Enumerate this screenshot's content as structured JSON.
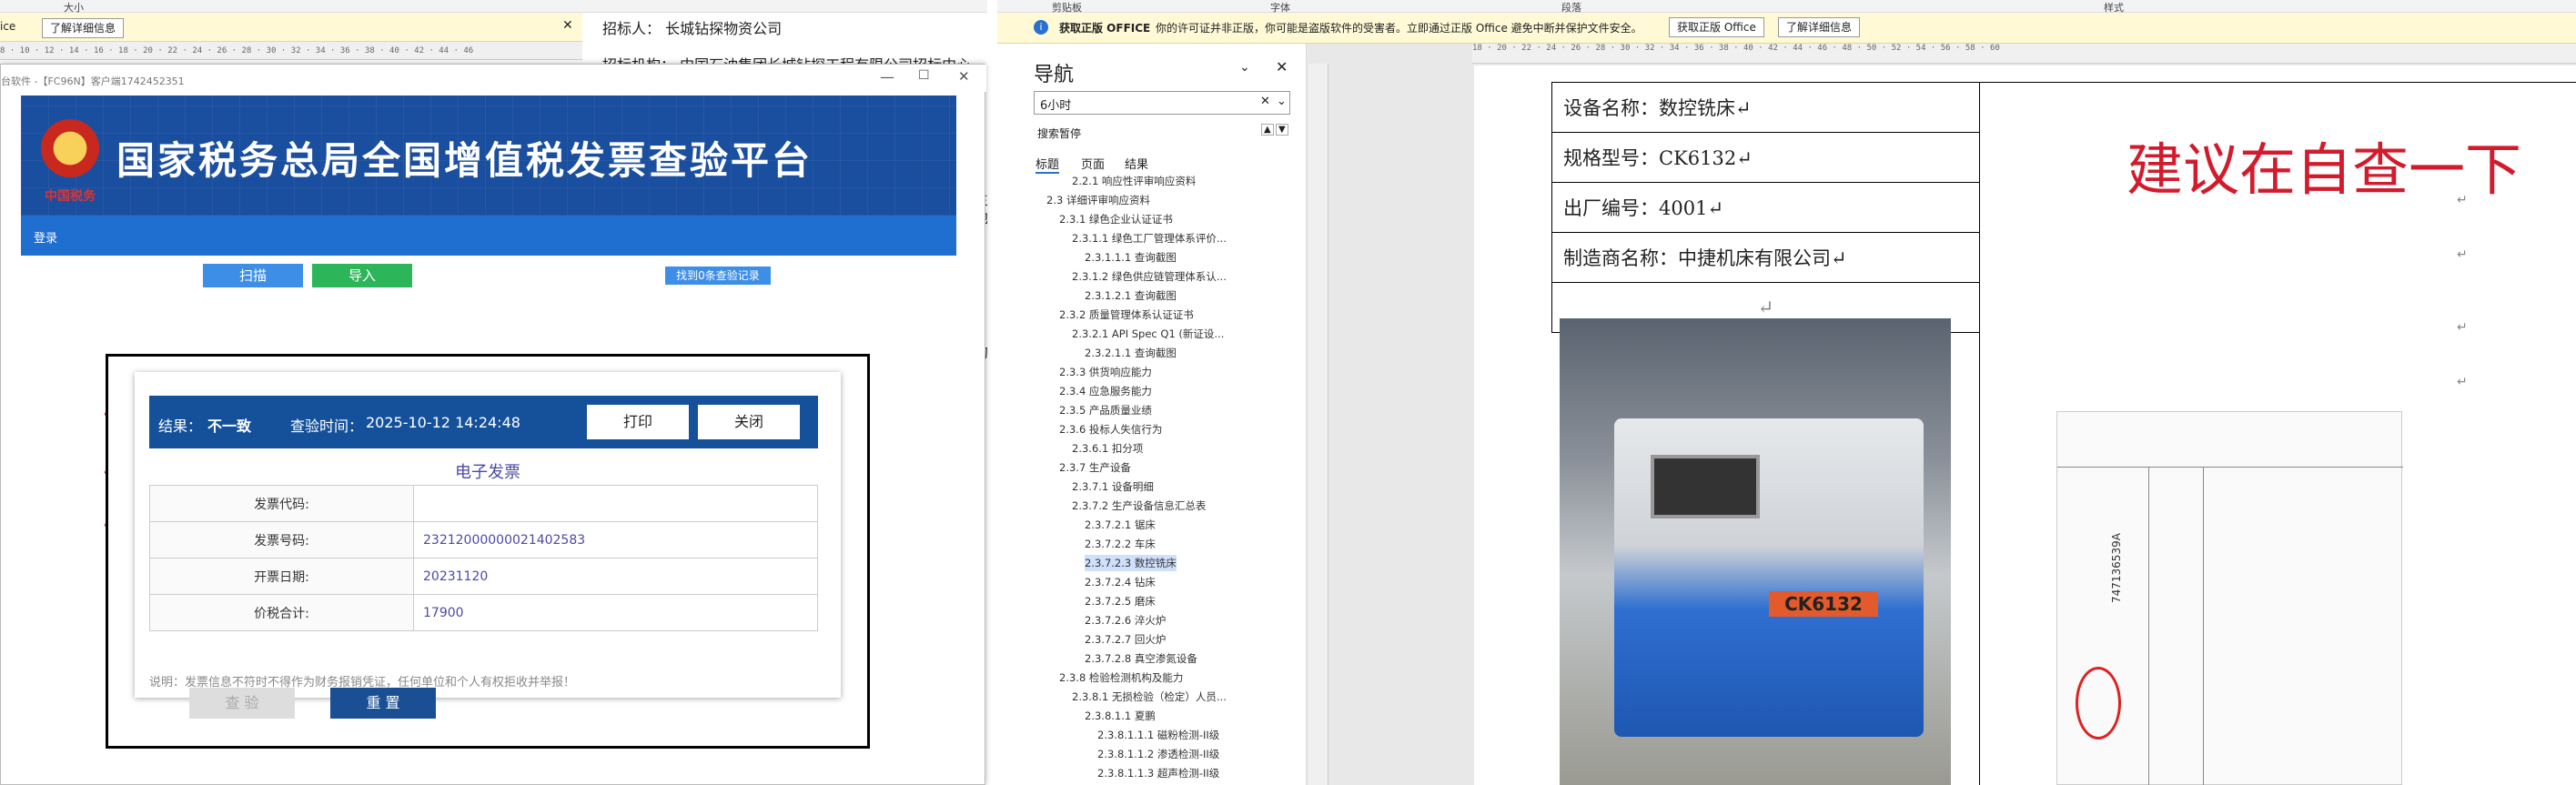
{
  "left_window": {
    "ribbon_group": "大小",
    "warn_partial": "ice",
    "warn_button": "了解详细信息",
    "ruler_ticks": "8 · 10 · 12 · 14 · 16 · 18 · 20 · 22 · 24 · 26 · 28 · 30 · 32 · 34 · 36 · 38 · 40 · 42 · 44 · 46",
    "doc_lines": [
      "招标人：   长城钻探物资公司",
      "招标机构：  中国石油集团长城钻探工程有限公司招标中心"
    ],
    "side_chars": [
      "主",
      "地",
      "的"
    ]
  },
  "popup": {
    "title": "台软件 -【FC96N】客户端1742452351",
    "banner_title": "国家税务总局全国增值税发票查验平台",
    "banner_logo": "中国税务",
    "nav_login": "登录",
    "btn_scan": "扫描",
    "btn_import": "导入",
    "btn_history": "找到0条查验记录",
    "result": {
      "label_result": "结果：",
      "value_result": "不一致",
      "label_time": "查验时间：",
      "value_time": "2025-10-12 14:24:48",
      "btn_print": "打印",
      "btn_close": "关闭",
      "invoice_title": "电子发票",
      "rows": [
        {
          "key": "发票代码:",
          "value": ""
        },
        {
          "key": "发票号码:",
          "value": "23212000000021402583"
        },
        {
          "key": "开票日期:",
          "value": "20231120"
        },
        {
          "key": "价税合计:",
          "value": "17900"
        }
      ],
      "note": "说明：发票信息不符时不得作为财务报销凭证，任何单位和个人有权拒收并举报！"
    },
    "btn_check": "查 验",
    "btn_reset": "重 置"
  },
  "right_window": {
    "ribbon": [
      "剪贴板",
      "字体",
      "段落",
      "样式"
    ],
    "warn_label": "获取正版 OFFICE",
    "warn_text": "你的许可证并非正版，你可能是盗版软件的受害者。立即通过正版 Office 避免中断并保护文件安全。",
    "warn_btn1": "获取正版 Office",
    "warn_btn2": "了解详细信息",
    "ruler_ticks": "18 · 20 · 22 · 24 · 26 · 28 · 30 · 32 · 34 · 36 · 38 · 40 · 42 · 44 · 46 · 48 · 50 · 52 · 54 · 56 · 58 · 60",
    "nav": {
      "title": "导航",
      "search_value": "6小时",
      "search_paused": "搜索暂停",
      "tabs": [
        "标题",
        "页面",
        "结果"
      ],
      "items": [
        {
          "t": "2.2.1 响应性评审响应资料",
          "l": 3
        },
        {
          "t": "2.3 详细评审响应资料",
          "l": 1
        },
        {
          "t": "2.3.1 绿色企业认证证书",
          "l": 2
        },
        {
          "t": "2.3.1.1 绿色工厂管理体系评价...",
          "l": 3
        },
        {
          "t": "2.3.1.1.1 查询截图",
          "l": 4
        },
        {
          "t": "2.3.1.2 绿色供应链管理体系认...",
          "l": 3
        },
        {
          "t": "2.3.1.2.1 查询截图",
          "l": 4
        },
        {
          "t": "2.3.2 质量管理体系认证证书",
          "l": 2
        },
        {
          "t": "2.3.2.1 API Spec Q1 (新证设...",
          "l": 3
        },
        {
          "t": "2.3.2.1.1 查询截图",
          "l": 4
        },
        {
          "t": "2.3.3 供货响应能力",
          "l": 2
        },
        {
          "t": "2.3.4 应急服务能力",
          "l": 2
        },
        {
          "t": "2.3.5 产品质量业绩",
          "l": 2
        },
        {
          "t": "2.3.6 投标人失信行为",
          "l": 2
        },
        {
          "t": "2.3.6.1 扣分项",
          "l": 3
        },
        {
          "t": "2.3.7 生产设备",
          "l": 2
        },
        {
          "t": "2.3.7.1 设备明细",
          "l": 3
        },
        {
          "t": "2.3.7.2 生产设备信息汇总表",
          "l": 3
        },
        {
          "t": "2.3.7.2.1 锯床",
          "l": 4
        },
        {
          "t": "2.3.7.2.2 车床",
          "l": 4
        },
        {
          "t": "2.3.7.2.3 数控铣床",
          "l": 4,
          "sel": true
        },
        {
          "t": "2.3.7.2.4 钻床",
          "l": 4
        },
        {
          "t": "2.3.7.2.5 磨床",
          "l": 4
        },
        {
          "t": "2.3.7.2.6 淬火炉",
          "l": 4
        },
        {
          "t": "2.3.7.2.7 回火炉",
          "l": 4
        },
        {
          "t": "2.3.7.2.8 真空渗氮设备",
          "l": 4
        },
        {
          "t": "2.3.8 检验检测机构及能力",
          "l": 2
        },
        {
          "t": "2.3.8.1 无损检验（检定）人员...",
          "l": 3
        },
        {
          "t": "2.3.8.1.1 夏鹏",
          "l": 4
        },
        {
          "t": "2.3.8.1.1.1 磁粉检测-II级",
          "l": 5
        },
        {
          "t": "2.3.8.1.1.2 渗透检测-II级",
          "l": 5
        },
        {
          "t": "2.3.8.1.1.3 超声检测-II级",
          "l": 5
        }
      ]
    },
    "doc": {
      "rows": [
        "设备名称：数控铣床↵",
        "规格型号：CK6132↵",
        "出厂编号：4001↵",
        "制造商名称：中捷机床有限公司↵"
      ],
      "empty_mark": "↵",
      "red_note": "建议在自查一下",
      "plate_text": "CK6132",
      "receipt_text": "747136539A"
    }
  }
}
